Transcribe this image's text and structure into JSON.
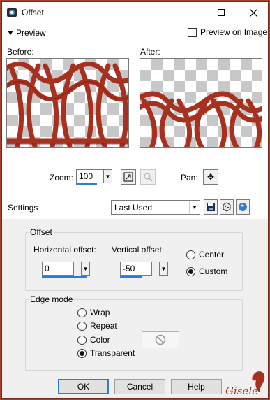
{
  "window": {
    "title": "Offset"
  },
  "preview": {
    "toggle_label": "Preview",
    "on_image_label": "Preview on Image",
    "on_image_checked": false,
    "before_label": "Before:",
    "after_label": "After:"
  },
  "zoom": {
    "label": "Zoom:",
    "value": "100"
  },
  "pan": {
    "label": "Pan:"
  },
  "settings": {
    "label": "Settings",
    "preset": "Last Used"
  },
  "offset": {
    "group_label": "Offset",
    "horizontal_label": "Horizontal offset:",
    "horizontal_value": "0",
    "vertical_label": "Vertical offset:",
    "vertical_value": "-50",
    "center_label": "Center",
    "custom_label": "Custom",
    "selected": "Custom"
  },
  "edge_mode": {
    "group_label": "Edge mode",
    "options": [
      "Wrap",
      "Repeat",
      "Color",
      "Transparent"
    ],
    "selected": "Transparent"
  },
  "buttons": {
    "ok": "OK",
    "cancel": "Cancel",
    "help": "Help"
  },
  "watermark": {
    "text": "Gisele"
  },
  "colors": {
    "accent": "#2f7cd8",
    "pattern": "#a8301f",
    "frame": "#a8402a"
  },
  "icons": [
    "app-icon",
    "minimize-icon",
    "maximize-icon",
    "close-icon",
    "fit-zoom-icon",
    "zoom-actual-icon",
    "pan-icon",
    "save-preset-icon",
    "randomize-icon",
    "reset-icon",
    "no-color-icon"
  ]
}
